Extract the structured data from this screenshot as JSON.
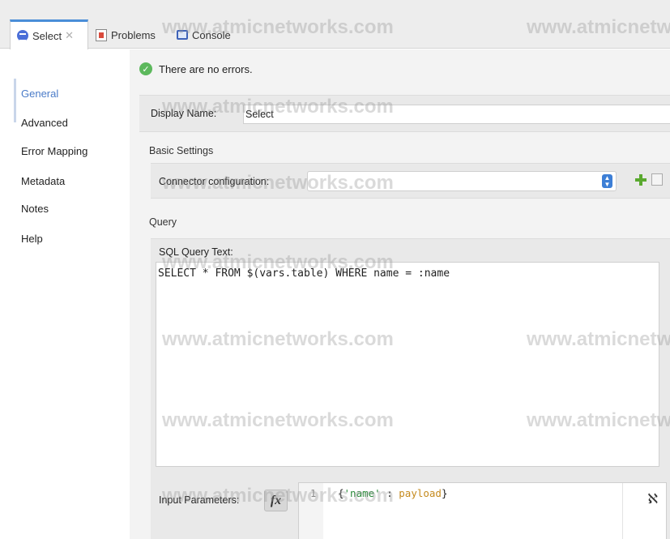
{
  "tabs": [
    {
      "label": "Select",
      "active": true,
      "icon": "database-icon"
    },
    {
      "label": "Problems",
      "active": false,
      "icon": "problems-icon"
    },
    {
      "label": "Console",
      "active": false,
      "icon": "console-icon"
    }
  ],
  "tab_close": "✕",
  "sidebar": {
    "items": [
      {
        "label": "General",
        "active": true
      },
      {
        "label": "Advanced"
      },
      {
        "label": "Error Mapping"
      },
      {
        "label": "Metadata"
      },
      {
        "label": "Notes"
      },
      {
        "label": "Help"
      }
    ]
  },
  "status": {
    "text": "There are no errors.",
    "icon": "check-circle-icon",
    "color": "#5cb85c"
  },
  "display_name": {
    "label": "Display Name:",
    "value": "Select"
  },
  "basic_settings": {
    "title": "Basic Settings",
    "connector_label": "Connector configuration:",
    "connector_value": ""
  },
  "query": {
    "title": "Query",
    "sql_label": "SQL Query Text:",
    "sql_text": "SELECT * FROM $(vars.table) WHERE name = :name",
    "input_params_label": "Input Parameters:",
    "fx_label": "fx",
    "line_number": "1",
    "code": {
      "open": "{",
      "key": "'name'",
      "sep": " : ",
      "value": "payload",
      "close": "}"
    }
  },
  "watermark": "www.atmicnetworks.com",
  "accent_color": "#4a8ed8"
}
